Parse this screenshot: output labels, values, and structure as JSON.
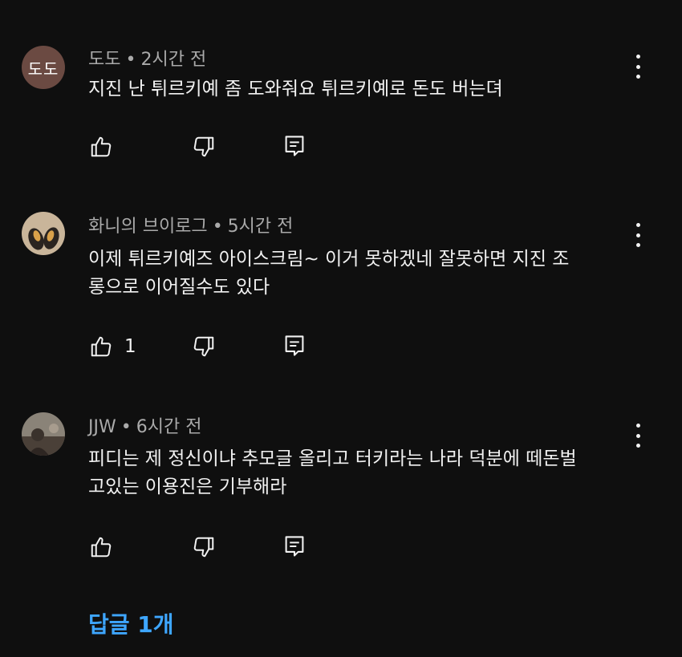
{
  "comments": [
    {
      "author": "도도",
      "avatar_text": "도도",
      "time": "2시간 전",
      "separator": "•",
      "text_lines": [
        "지진 난 튀르키예 좀 도와줘요 튀르키예로 돈도 버는뎌"
      ],
      "like_count": ""
    },
    {
      "author": "화니의 브이로그",
      "time": "5시간 전",
      "separator": "•",
      "text_lines": [
        "이제 튀르키예즈 아이스크림~ 이거 못하겠네 잘못하면 지진 조",
        "롱으로 이어질수도 있다"
      ],
      "like_count": "1"
    },
    {
      "author": "JJW",
      "time": "6시간 전",
      "separator": "•",
      "text_lines": [
        "피디는 제 정신이냐 추모글 올리고 터키라는 나라 덕분에 떼돈벌",
        "고있는 이용진은 기부해라"
      ],
      "like_count": ""
    }
  ],
  "replies_link": "답글 1개",
  "icons": {
    "like": "thumbs-up-icon",
    "dislike": "thumbs-down-icon",
    "reply": "comment-reply-icon",
    "more": "more-vertical-icon"
  },
  "colors": {
    "background": "#0f0f0f",
    "text": "#f1f1f1",
    "meta": "#aaaaaa",
    "link": "#3ea6ff"
  }
}
